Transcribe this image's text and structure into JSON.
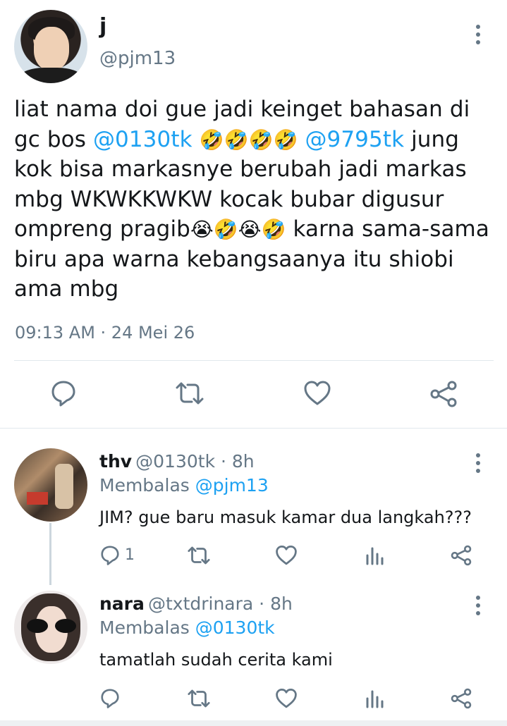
{
  "main_tweet": {
    "name": "j",
    "handle": "@pjm13",
    "text_parts": [
      {
        "t": "liat nama doi gue jadi keinget bahasan di gc bos "
      },
      {
        "t": "@0130tk",
        "mention": true
      },
      {
        "t": " "
      },
      {
        "t": "🤣🤣🤣🤣",
        "emoji": true
      },
      {
        "t": " "
      },
      {
        "t": "@9795tk",
        "mention": true
      },
      {
        "t": " jung kok bisa markasnye berubah jadi markas mbg WKWKKWKW kocak bubar digusur ompreng pragib"
      },
      {
        "t": "😭🤣😭🤣",
        "emoji": true
      },
      {
        "t": " karna sama-sama biru apa warna kebangsaanya itu shiobi ama mbg"
      }
    ],
    "timestamp": "09:13 AM · 24 Mei 26"
  },
  "replies": [
    {
      "name": "thv",
      "meta": "@0130tk · 8h",
      "replying_prefix": "Membalas",
      "replying_to": "@pjm13",
      "text": "JIM? gue baru masuk kamar dua langkah???",
      "reply_count": "1"
    },
    {
      "name": "nara",
      "meta": "@txtdrinara · 8h",
      "replying_prefix": "Membalas",
      "replying_to": "@0130tk",
      "text": "tamatlah sudah cerita kami",
      "reply_count": ""
    }
  ],
  "icons": {
    "main_actions": [
      "reply-icon",
      "retweet-icon",
      "like-icon",
      "share-icon"
    ],
    "reply_actions": [
      "reply-icon",
      "retweet-icon",
      "like-icon",
      "analytics-icon",
      "share-icon"
    ],
    "more": "more-vertical-icon"
  },
  "colors": {
    "link": "#1da1f2",
    "secondary": "#657786",
    "text": "#14171a",
    "divider": "#e1e8ed"
  }
}
